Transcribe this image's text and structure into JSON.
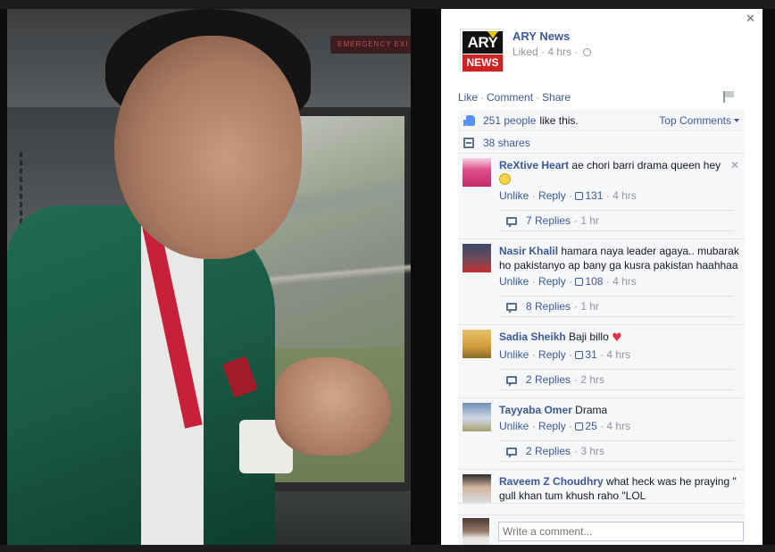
{
  "post": {
    "page_name": "ARY News",
    "liked_label": "Liked",
    "time": "4 hrs",
    "logo_top": "ARY",
    "logo_bottom": "NEWS",
    "photo_sign": "EMERGENCY EXI",
    "actions": {
      "like": "Like",
      "comment": "Comment",
      "share": "Share",
      "sep": "·"
    }
  },
  "stats": {
    "likes_count": "251 people",
    "likes_rest": "like this.",
    "top_comments": "Top Comments",
    "shares": "38 shares"
  },
  "comments": [
    {
      "author": "ReXtive Heart",
      "text": "ae chori barri drama queen hey",
      "emoji": "smiley",
      "unlike": "Unlike",
      "reply": "Reply",
      "likes": "131",
      "time": "4 hrs",
      "replies": "7 Replies",
      "replies_time": "1 hr"
    },
    {
      "author": "Nasir Khalil",
      "text": "hamara naya leader agaya.. mubarak ho pakistanyo ap bany ga kusra pakistan haahhaa",
      "unlike": "Unlike",
      "reply": "Reply",
      "likes": "108",
      "time": "4 hrs",
      "replies": "8 Replies",
      "replies_time": "1 hr"
    },
    {
      "author": "Sadia Sheikh",
      "text": "Baji billo",
      "emoji": "heart",
      "unlike": "Unlike",
      "reply": "Reply",
      "likes": "31",
      "time": "4 hrs",
      "replies": "2 Replies",
      "replies_time": "2 hrs"
    },
    {
      "author": "Tayyaba Omer",
      "text": "Drama",
      "unlike": "Unlike",
      "reply": "Reply",
      "likes": "25",
      "time": "4 hrs",
      "replies": "2 Replies",
      "replies_time": "3 hrs"
    },
    {
      "author": "Raveem Z Choudhry",
      "text": "what heck was he praying \" gull khan tum khush raho \"LOL"
    }
  ],
  "composer": {
    "placeholder": "Write a comment..."
  },
  "colors": {
    "link": "#3b5998",
    "meta": "#90949c",
    "panel_bg": "#f6f7f9",
    "logo_red": "#d02222"
  },
  "icons": [
    "close-icon",
    "globe-icon",
    "flag-icon",
    "like-thumb-icon",
    "share-icon",
    "reply-icon",
    "remove-icon"
  ]
}
